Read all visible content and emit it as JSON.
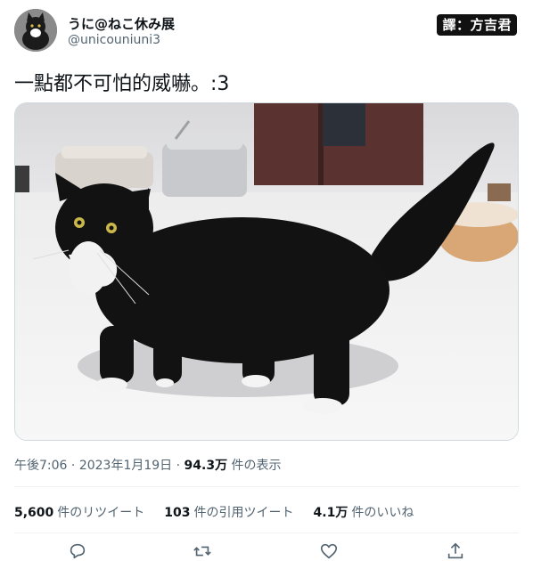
{
  "author": {
    "display_name": "うに@ねこ休み展",
    "handle": "@unicouniuni3"
  },
  "translator_badge": "譯：方吉君",
  "tweet": {
    "text": "一點都不可怕的威嚇。:3"
  },
  "meta": {
    "time": "午後7:06",
    "date": "2023年1月19日",
    "views_count": "94.3万",
    "views_label": "件の表示"
  },
  "stats": {
    "retweets_count": "5,600",
    "retweets_label": "件のリツイート",
    "quotes_count": "103",
    "quotes_label": "件の引用ツイート",
    "likes_count": "4.1万",
    "likes_label": "件のいいね"
  },
  "actions": [
    {
      "icon": "reply-icon"
    },
    {
      "icon": "retweet-icon"
    },
    {
      "icon": "like-icon"
    },
    {
      "icon": "share-icon"
    }
  ],
  "colors": {
    "text_primary": "#0f1419",
    "text_secondary": "#536471",
    "divider": "#eff3f4"
  }
}
